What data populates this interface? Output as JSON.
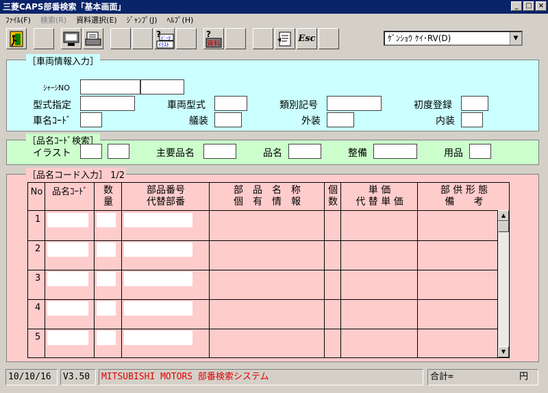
{
  "window": {
    "title": "三菱CAPS部番検索「基本画面」",
    "controls": [
      "_",
      "□",
      "×"
    ]
  },
  "menu": [
    {
      "label": "ﾌｧｲﾙ(F)",
      "enabled": true
    },
    {
      "label": "検索(R)",
      "enabled": false
    },
    {
      "label": "資料選択(E)",
      "enabled": true
    },
    {
      "label": "ｼﾞｬﾝﾌﾟ(J)",
      "enabled": true
    },
    {
      "label": "ﾍﾙﾌﾟ(H)",
      "enabled": true
    }
  ],
  "toolbar": {
    "illust_label": "ｲﾗｽﾄ",
    "data_label": "ﾃﾞｰﾀ",
    "shiryo_label": "資料",
    "esc_label": "Esc"
  },
  "model_select": {
    "value": "ｹﾞﾝｼｮｳ ｹｲ･RV(D)"
  },
  "vehicle": {
    "title": "［車両情報入力］",
    "chassis_label": "ｼｬｰｼNO",
    "katashiki_label": "型式指定",
    "sharyo_label": "車両型式",
    "ruibetsu_label": "類別記号",
    "shodo_label": "初度登録",
    "shamei_label": "車名ｺｰﾄﾞ",
    "gisou_label": "艤装",
    "gaisou_label": "外装",
    "naisou_label": "内装"
  },
  "search": {
    "title": "［品名ｺｰﾄﾞ検索］",
    "illust_label": "イラスト",
    "main_label": "主要品名",
    "hinmei_label": "品名",
    "seibi_label": "整備",
    "youhin_label": "用品"
  },
  "grid": {
    "title": "［品名コード入力］ 1/2",
    "headers": {
      "no": "No",
      "code": "品名ｺｰﾄﾞ",
      "qty1": "数",
      "qty2": "量",
      "part1": "部品番号",
      "part2": "代替部番",
      "name1": "部　品　名　称",
      "name2": "個　有　情　報",
      "count1": "個",
      "count2": "数",
      "price1": "単 価",
      "price2": "代 替 単 価",
      "note1": "部 供 形 態",
      "note2": "備　　考"
    },
    "rows": [
      "1",
      "2",
      "3",
      "4",
      "5"
    ]
  },
  "status": {
    "date": "10/10/16",
    "version": "V3.50",
    "system": "MITSUBISHI MOTORS 部番検索システム",
    "total_label": "合計=",
    "total_unit": "円"
  }
}
